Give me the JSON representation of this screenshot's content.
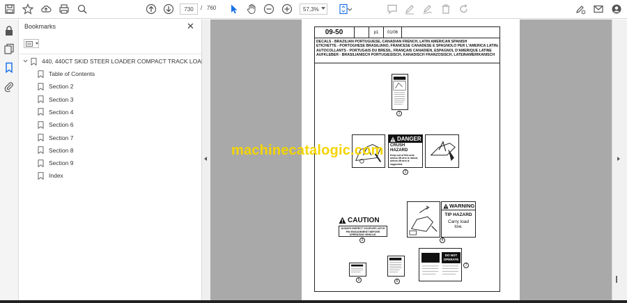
{
  "toolbar": {
    "page_current": "730",
    "page_separator": "/",
    "page_total": "760",
    "zoom": "57,3%"
  },
  "bookmarks_panel": {
    "title": "Bookmarks",
    "close_glyph": "✕",
    "root": "440, 440CT SKID STEER LOADER COMPACT TRACK LOADER",
    "items": [
      {
        "label": "Table of Contents"
      },
      {
        "label": "Section 2"
      },
      {
        "label": "Section 3"
      },
      {
        "label": "Section 4"
      },
      {
        "label": "Section 6"
      },
      {
        "label": "Section 7"
      },
      {
        "label": "Section 8"
      },
      {
        "label": "Section 9"
      },
      {
        "label": "Index"
      }
    ]
  },
  "document": {
    "header": {
      "section": "09-50",
      "page": "p1",
      "date": "01/06"
    },
    "description_lines": [
      "DECALS - BRAZILIAN PORTUGUESE, CANADIAN FRENCH, LATIN AMERICAN SPANISH",
      "ETICHETTE - PORTOGHESE BRASILIANO, FRANCESE CANADESE E SPAGNOLO PER L'AMERICA LATINA",
      "AUTOCOLLANTS - PORTUGAIS DU BRÉSIL, FRANÇAIS CANADIEN, ESPAGNOL D'AMÉRIQUE LATINE",
      "AUFKLEBER - BRASILIANISCH PORTUGIESISCH, KANADISCH FRANZÖSISCH, LATEINAMERIKANISCH"
    ],
    "decals": {
      "danger_header": "DANGER",
      "crush_title": "CRUSH HAZARD",
      "crush_text": "Keep out of this area unless lift arm is raised, unless lift arm is supported.",
      "caution_header": "CAUTION",
      "caution_text": "ALWAYS INSPECT COUPLER LATCH PIN ENGAGEMENT BEFORE OPERATING VEHICLE.",
      "warning_header": "WARNING",
      "tip_title": "TIP HAZARD",
      "tip_text": "Carry load low.",
      "do_not_operate": "DO NOT OPERATE",
      "callouts": [
        "1",
        "2",
        "3",
        "4",
        "5",
        "6",
        "7"
      ]
    },
    "watermark": "machinecatalogic.com"
  },
  "colors": {
    "accent": "#1a73e8",
    "doc_background": "#a9a9a9",
    "watermark": "#f4d400"
  }
}
